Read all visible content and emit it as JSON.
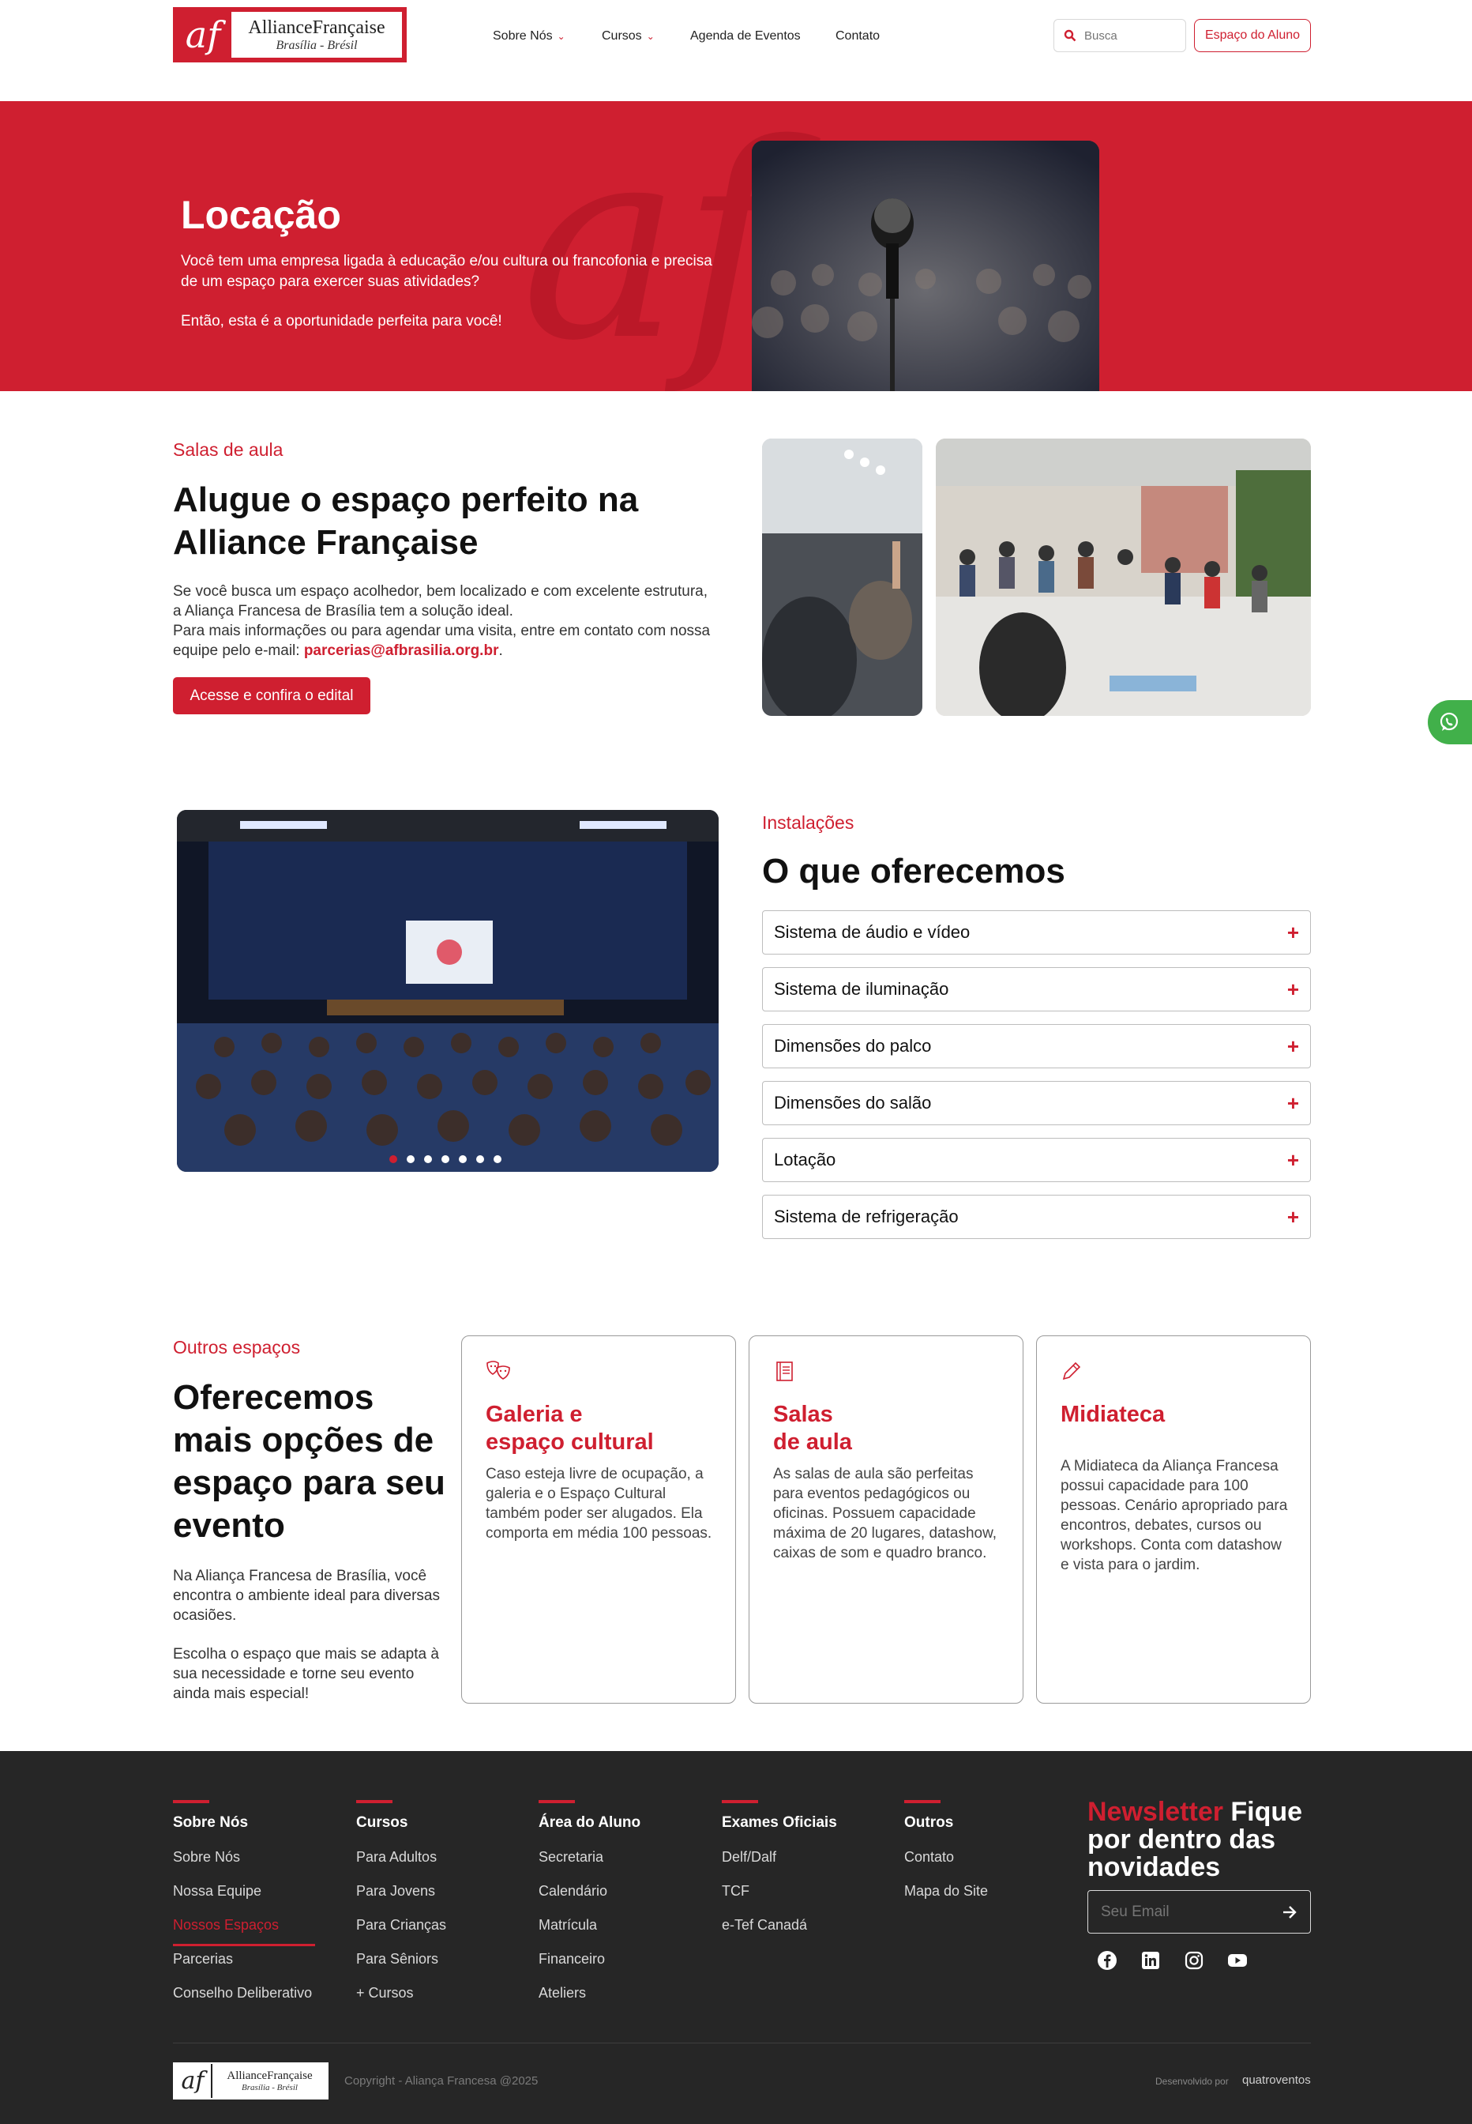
{
  "header": {
    "logo_main": "AllianceFrançaise",
    "logo_sub": "Brasília - Brésil",
    "nav": [
      "Sobre Nós",
      "Cursos",
      "Agenda de Eventos",
      "Contato"
    ],
    "search_placeholder": "Busca",
    "student_button": "Espaço do Aluno"
  },
  "hero": {
    "title": "Locação",
    "text1": "Você tem uma empresa ligada à educação e/ou cultura ou francofonia e precisa de um espaço para exercer suas atividades?",
    "text2": "Então, esta é a oportunidade perfeita para você!"
  },
  "salas": {
    "eyebrow": "Salas de aula",
    "title": "Alugue o espaço perfeito na Alliance Française",
    "text1": "Se você busca um espaço acolhedor, bem localizado e com excelente estrutura, a Aliança Francesa de Brasília tem a solução ideal.",
    "text2": "Para mais informações ou para agendar uma visita, entre em contato com nossa equipe pelo e-mail: ",
    "email": "parcerias@afbrasilia.org.br",
    "period": ".",
    "button": "Acesse e confira o edital"
  },
  "instalacoes": {
    "eyebrow": "Instalações",
    "title": "O que oferecemos",
    "items": [
      "Sistema de áudio e vídeo",
      "Sistema de iluminação",
      "Dimensões do palco",
      "Dimensões do salão",
      "Lotação",
      "Sistema de refrigeração"
    ],
    "carousel": {
      "slides": 7,
      "active": 1
    }
  },
  "outros": {
    "eyebrow": "Outros espaços",
    "title": "Oferecemos mais opções de espaço para seu evento",
    "text1": "Na Aliança Francesa de Brasília, você encontra o ambiente ideal para diversas ocasiões.",
    "text2": "Escolha o espaço que mais se adapta à sua necessidade e torne seu evento ainda mais especial!",
    "cards": [
      {
        "title_l1": "Galeria e",
        "title_l2": "espaço cultural",
        "icon": "theater-masks-icon",
        "desc": "Caso esteja livre de ocupação, a galeria e o Espaço Cultural também poder ser alugados. Ela comporta em média 100 pessoas."
      },
      {
        "title_l1": "Salas",
        "title_l2": "de aula",
        "icon": "notebook-icon",
        "desc": "As salas de aula são perfeitas para eventos pedagógicos ou oficinas. Possuem capacidade máxima de 20 lugares, datashow, caixas de som e quadro branco."
      },
      {
        "title_l1": "Midiateca",
        "title_l2": "",
        "icon": "pen-icon",
        "desc": "A Midiateca da Aliança Francesa possui capacidade para 100 pessoas. Cenário apropriado para encontros, debates, cursos ou workshops. Conta com datashow e vista para o jardim."
      }
    ]
  },
  "footer": {
    "columns": [
      {
        "title": "Sobre Nós",
        "items": [
          "Sobre Nós",
          "Nossa Equipe",
          "Nossos Espaços",
          "Parcerias",
          "Conselho Deliberativo"
        ]
      },
      {
        "title": "Cursos",
        "items": [
          "Para Adultos",
          "Para Jovens",
          "Para Crianças",
          "Para Sêniors",
          "+ Cursos"
        ]
      },
      {
        "title": "Área do Aluno",
        "items": [
          "Secretaria",
          "Calendário",
          "Matrícula",
          "Financeiro",
          "Ateliers"
        ]
      },
      {
        "title": "Exames Oficiais",
        "items": [
          "Delf/Dalf",
          "TCF",
          "e-Tef Canadá"
        ]
      },
      {
        "title": "Outros",
        "items": [
          "Contato",
          "Mapa do Site"
        ]
      }
    ],
    "newsletter_red": "Newsletter",
    "newsletter_white": " Fique por dentro das novidades",
    "email_placeholder": "Seu Email",
    "copyright": "Copyright - Aliança Francesa @2025",
    "developed_by": "Desenvolvido por",
    "developer": "quatroventos",
    "logo_main": "AllianceFrançaise",
    "logo_sub": "Brasília - Brésil"
  },
  "colors": {
    "brand_red": "#cf1f30",
    "footer_bg": "#262626",
    "whatsapp_green": "#41b04a"
  }
}
